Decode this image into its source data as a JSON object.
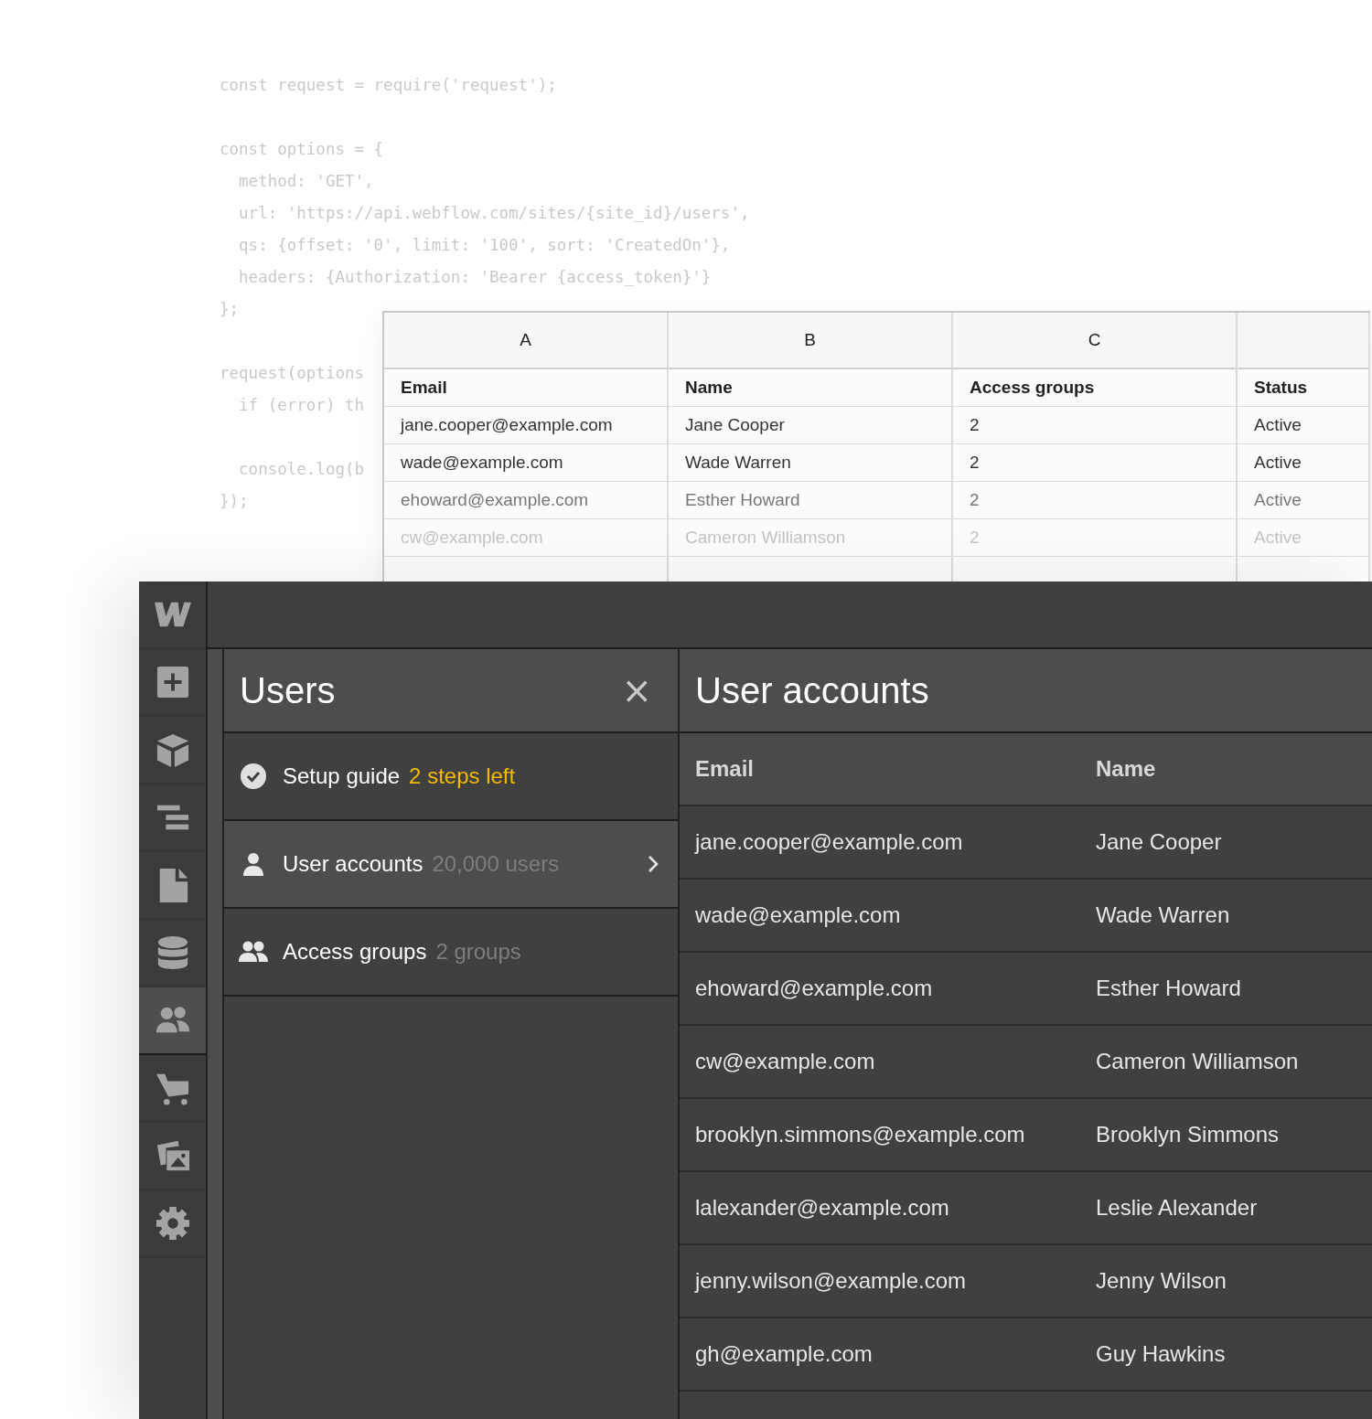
{
  "code": {
    "lines": [
      {
        "text": "const request = require('request');",
        "gap_before": false
      },
      {
        "text": "const options = {",
        "gap_before": true
      },
      {
        "text": "  method: 'GET',",
        "gap_before": false
      },
      {
        "text": "  url: 'https://api.webflow.com/sites/{site_id}/users',",
        "gap_before": false
      },
      {
        "text": "  qs: {offset: '0', limit: '100', sort: 'CreatedOn'},",
        "gap_before": false
      },
      {
        "text": "  headers: {Authorization: 'Bearer {access_token}'}",
        "gap_before": false
      },
      {
        "text": "};",
        "gap_before": false
      },
      {
        "text": "request(options",
        "gap_before": true
      },
      {
        "text": "  if (error) th",
        "gap_before": false
      },
      {
        "text": "  console.log(b",
        "gap_before": true
      },
      {
        "text": "});",
        "gap_before": false
      }
    ]
  },
  "spreadsheet": {
    "column_letters": [
      "A",
      "B",
      "C"
    ],
    "columns": [
      "Email",
      "Name",
      "Access groups",
      "Status"
    ],
    "rows": [
      [
        "jane.cooper@example.com",
        "Jane Cooper",
        "2",
        "Active"
      ],
      [
        "wade@example.com",
        "Wade Warren",
        "2",
        "Active"
      ],
      [
        "ehoward@example.com",
        "Esther Howard",
        "2",
        "Active"
      ],
      [
        "cw@example.com",
        "Cameron Williamson",
        "2",
        "Active"
      ]
    ]
  },
  "toolbar": {
    "items": [
      {
        "kind": "add",
        "selected": false
      },
      {
        "kind": "components",
        "selected": false
      },
      {
        "kind": "navigator",
        "selected": false
      },
      {
        "kind": "pages",
        "selected": false
      },
      {
        "kind": "cms",
        "selected": false
      },
      {
        "kind": "users",
        "selected": true
      },
      {
        "kind": "ecommerce",
        "selected": false
      },
      {
        "kind": "assets",
        "selected": false
      },
      {
        "kind": "settings",
        "selected": false
      }
    ]
  },
  "users_panel": {
    "title": "Users",
    "close": "×",
    "items": [
      {
        "kind": "guide",
        "label": "Setup guide",
        "detail": "2 steps left",
        "selected": false
      },
      {
        "kind": "accounts",
        "label": "User accounts",
        "detail": "20,000 users",
        "selected": true
      },
      {
        "kind": "groups",
        "label": "Access groups",
        "detail": "2 groups",
        "selected": false
      }
    ]
  },
  "accounts": {
    "title": "User accounts",
    "columns": [
      "Email",
      "Name"
    ],
    "rows": [
      [
        "jane.cooper@example.com",
        "Jane Cooper"
      ],
      [
        "wade@example.com",
        "Wade Warren"
      ],
      [
        "ehoward@example.com",
        "Esther Howard"
      ],
      [
        "cw@example.com",
        "Cameron Williamson"
      ],
      [
        "brooklyn.simmons@example.com",
        "Brooklyn Simmons"
      ],
      [
        "lalexander@example.com",
        "Leslie Alexander"
      ],
      [
        "jenny.wilson@example.com",
        "Jenny Wilson"
      ],
      [
        "gh@example.com",
        "Guy Hawkins"
      ]
    ]
  }
}
